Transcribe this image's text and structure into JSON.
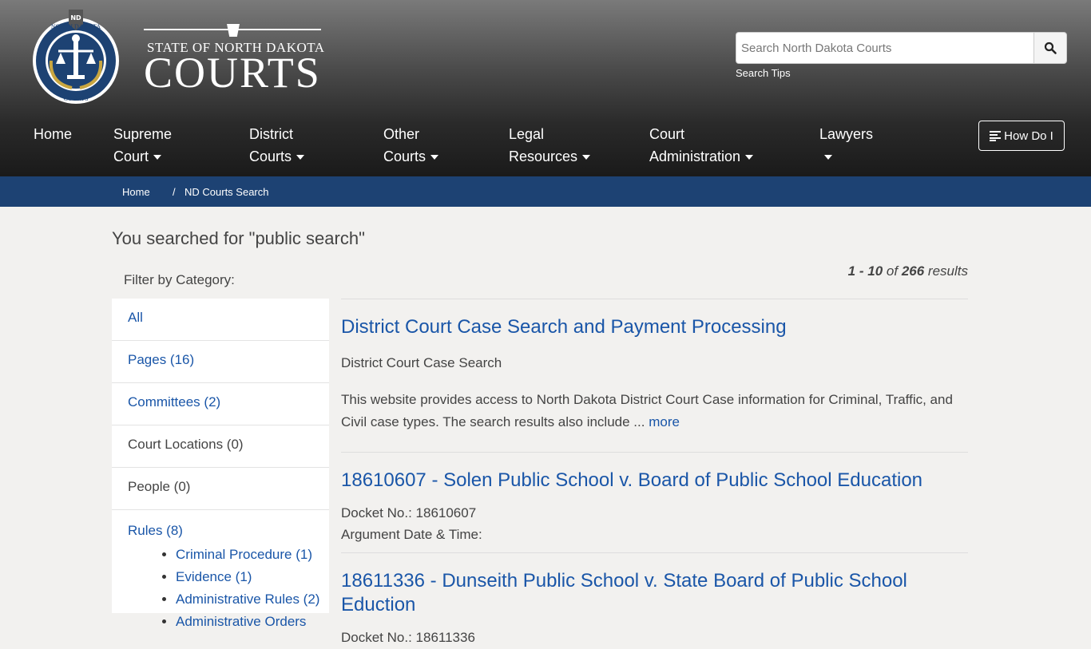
{
  "header": {
    "brand_top": "STATE OF NORTH DAKOTA",
    "brand_main": "COURTS",
    "seal_text": "NORTH DAKOTA",
    "seal_bottom": "COURTS",
    "seal_tag": "ND",
    "search_placeholder": "Search North Dakota Courts",
    "search_tips": "Search Tips",
    "how_do_i": "How Do I"
  },
  "nav": [
    {
      "line1": "Home",
      "line2": ""
    },
    {
      "line1": "Supreme",
      "line2": "Court"
    },
    {
      "line1": "District",
      "line2": "Courts"
    },
    {
      "line1": "Other",
      "line2": "Courts"
    },
    {
      "line1": "Legal",
      "line2": "Resources"
    },
    {
      "line1": "Court",
      "line2": "Administration"
    },
    {
      "line1": "Lawyers",
      "line2": ""
    }
  ],
  "breadcrumb": {
    "home": "Home",
    "sep": "/",
    "current": "ND Courts Search"
  },
  "main": {
    "title": "You searched for \"public search\"",
    "count_range": "1 - 10",
    "count_of": "of",
    "count_total": "266",
    "count_results": "results",
    "filter_label": "Filter by Category:"
  },
  "categories": [
    {
      "label": "All"
    },
    {
      "label": "Pages (16)"
    },
    {
      "label": "Committees (2)"
    },
    {
      "label": "Court Locations (0)"
    },
    {
      "label": "People (0)"
    },
    {
      "label": "Rules (8)"
    }
  ],
  "rule_subcategories": [
    {
      "label": "Criminal Procedure (1)"
    },
    {
      "label": "Evidence (1)"
    },
    {
      "label": "Administrative Rules (2)"
    },
    {
      "label": "Administrative Orders"
    }
  ],
  "results": [
    {
      "title": "District Court Case Search and Payment Processing",
      "subtitle": "District Court Case Search",
      "snippet": "This website provides access to North Dakota District Court Case information for Criminal, Traffic, and Civil case types. The search results also include ...",
      "more": "more"
    },
    {
      "title": "18610607 - Solen Public School v. Board of Public School Education",
      "docket": "Docket No.: 18610607",
      "argument": "Argument Date & Time:"
    },
    {
      "title": "18611336 - Dunseith Public School v. State Board of Public School Eduction",
      "docket": "Docket No.: 18611336"
    }
  ]
}
